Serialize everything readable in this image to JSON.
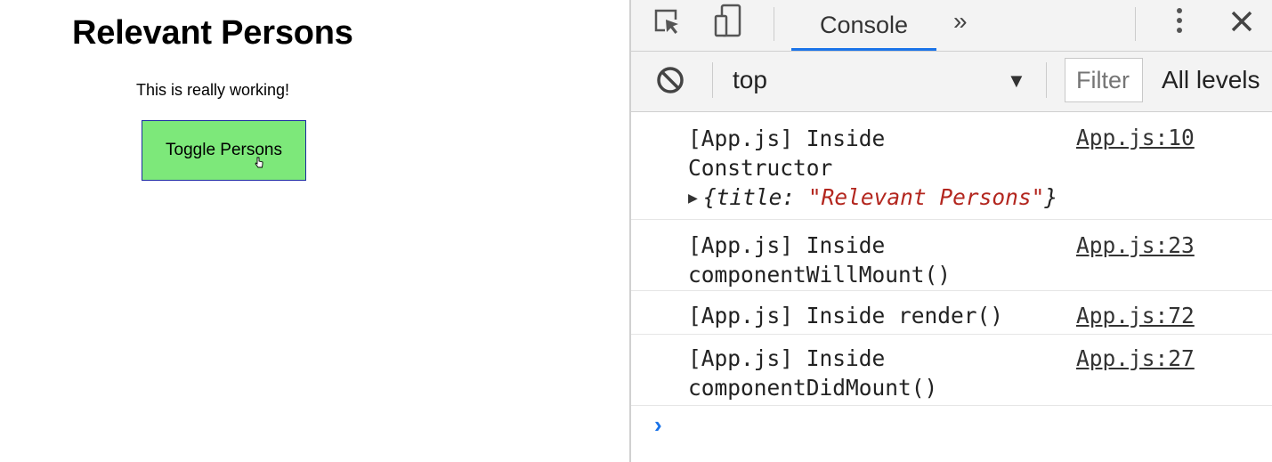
{
  "app": {
    "title": "Relevant Persons",
    "text": "This is really working!",
    "button_label": "Toggle Persons"
  },
  "devtools": {
    "tabs": {
      "console": "Console",
      "more": "»"
    },
    "toolbar": {
      "context": "top",
      "filter_placeholder": "Filter",
      "levels": "All levels"
    },
    "logs": [
      {
        "line1": "[App.js] Inside",
        "line2": "Constructor",
        "source": "App.js:10",
        "obj_open": "{",
        "obj_key": "title:",
        "obj_value": "\"Relevant Persons\"",
        "obj_close": "}"
      },
      {
        "line1": "[App.js] Inside",
        "line2": "componentWillMount()",
        "source": "App.js:23"
      },
      {
        "line1": "[App.js] Inside render()",
        "source": "App.js:72"
      },
      {
        "line1": "[App.js] Inside",
        "line2": "componentDidMount()",
        "source": "App.js:27"
      }
    ],
    "prompt": "›"
  },
  "colors": {
    "button_bg": "#7de87a",
    "button_border": "#1a2aa0",
    "accent": "#1a73e8",
    "string": "#b3261e"
  },
  "icons": [
    "inspect-element-icon",
    "device-toolbar-icon",
    "more-tabs-icon",
    "kebab-menu-icon",
    "close-icon",
    "clear-console-icon",
    "dropdown-arrow-icon",
    "console-prompt-icon"
  ]
}
